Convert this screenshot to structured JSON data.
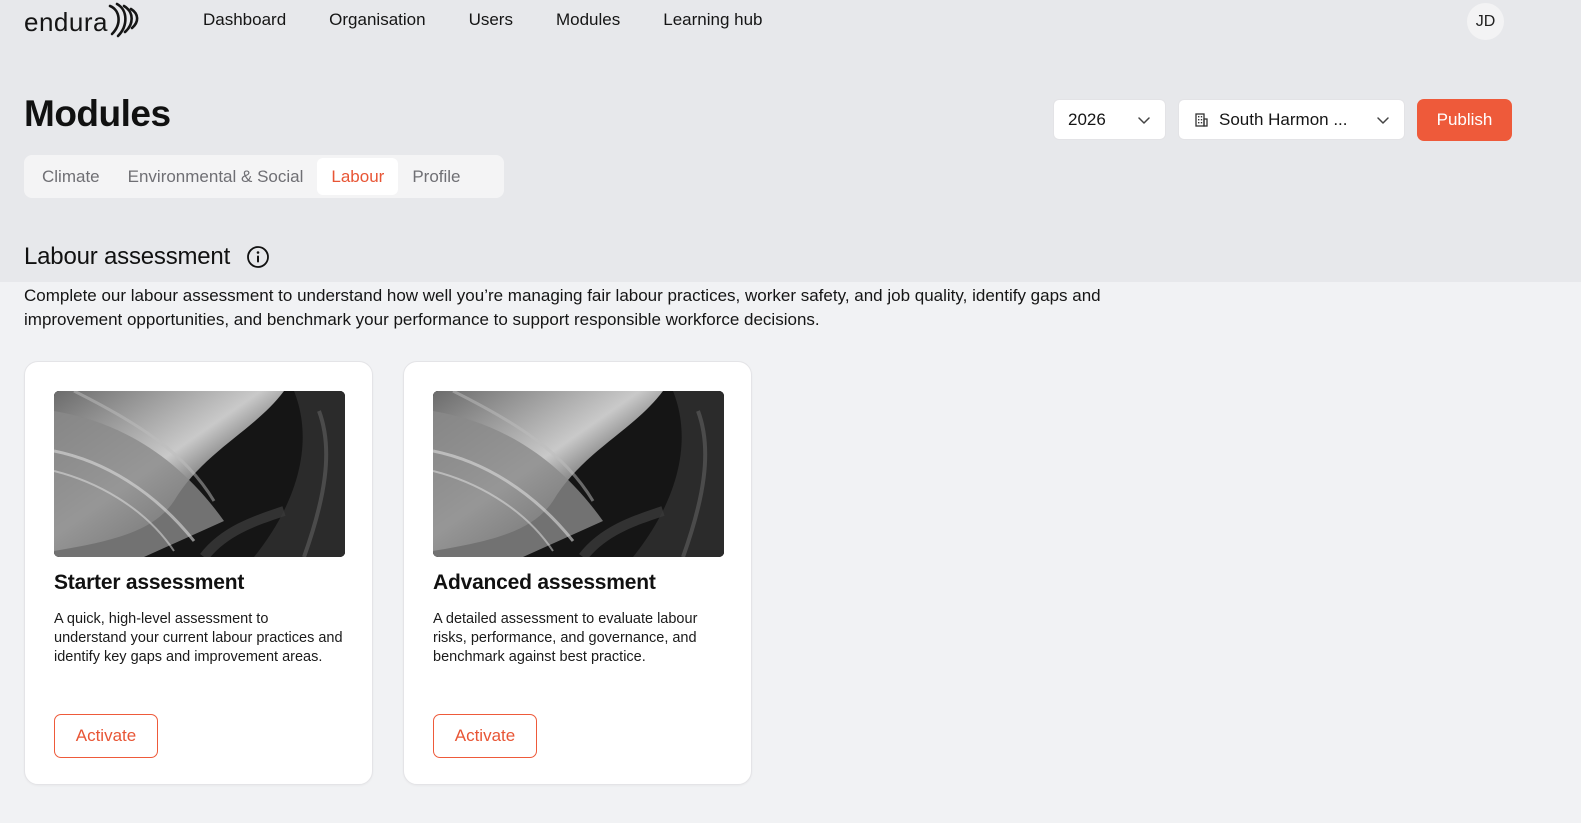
{
  "brand": {
    "name": "endura",
    "accent": "#ee5a3a"
  },
  "nav": {
    "items": [
      {
        "label": "Dashboard"
      },
      {
        "label": "Organisation"
      },
      {
        "label": "Users"
      },
      {
        "label": "Modules"
      },
      {
        "label": "Learning hub"
      }
    ],
    "avatar_initials": "JD"
  },
  "page": {
    "title": "Modules"
  },
  "controls": {
    "year": {
      "value": "2026",
      "icon": "chevron-down-icon"
    },
    "organisation": {
      "value": "South Harmon ...",
      "icon": "building-icon"
    },
    "publish_label": "Publish"
  },
  "tabs": [
    {
      "label": "Climate",
      "active": false
    },
    {
      "label": "Environmental & Social",
      "active": false
    },
    {
      "label": "Labour",
      "active": true
    },
    {
      "label": "Profile",
      "active": false
    }
  ],
  "section": {
    "title": "Labour assessment",
    "info_icon": "info-icon",
    "description": "Complete our labour assessment to understand how well you’re managing fair labour practices, worker safety, and job quality, identify gaps and improvement opportunities, and benchmark your performance to support responsible workforce decisions."
  },
  "cards": [
    {
      "title": "Starter assessment",
      "description": "A quick, high-level assessment to understand your current labour practices and identify key gaps and improvement areas.",
      "button_label": "Activate"
    },
    {
      "title": "Advanced assessment",
      "description": "A detailed assessment to evaluate labour risks, performance, and governance, and benchmark against best practice.",
      "button_label": "Activate"
    }
  ]
}
